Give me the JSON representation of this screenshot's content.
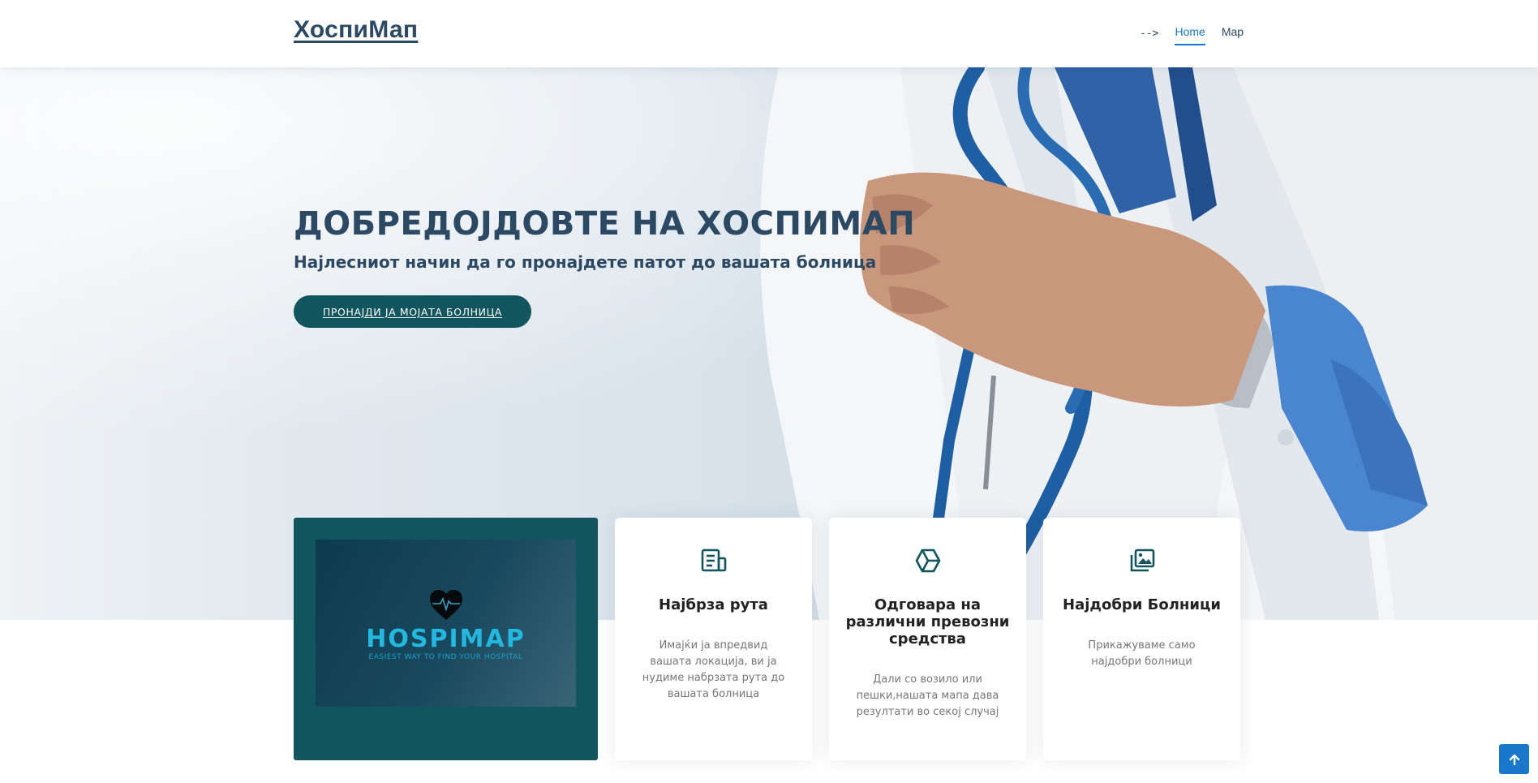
{
  "header": {
    "logo": "ХоспиМап",
    "stray_text": "-->",
    "nav": [
      {
        "label": "Home",
        "active": true
      },
      {
        "label": "Map",
        "active": false
      }
    ]
  },
  "hero": {
    "title": "ДОБРЕДОЈДОВТЕ НА ХОСПИМАП",
    "subtitle": "Најлесниот начин да го пронајдете патот до вашата болница",
    "cta_label": "ПРОНАЈДИ ЈА МОЈАТА БОЛНИЦА"
  },
  "brand_card": {
    "name": "HOSPIMAP",
    "tagline": "EASIEST WAY TO FIND YOUR HOSPITAL"
  },
  "features": [
    {
      "icon": "receipt-icon",
      "title": "Најбрза рута",
      "text": "Имајќи ја впредвид вашата локација, ви ја нудиме набрзата рута до вашата болница"
    },
    {
      "icon": "cube-icon",
      "title": "Одговара на различни превозни средства",
      "text": "Дали со возило или пешки,нашата мапа дава резултати во секој случај"
    },
    {
      "icon": "images-icon",
      "title": "Најдобри Болници",
      "text": "Прикажуваме само најдобри болници"
    }
  ],
  "colors": {
    "primary": "#1977cc",
    "heading": "#2c4964",
    "teal": "#11555f"
  }
}
